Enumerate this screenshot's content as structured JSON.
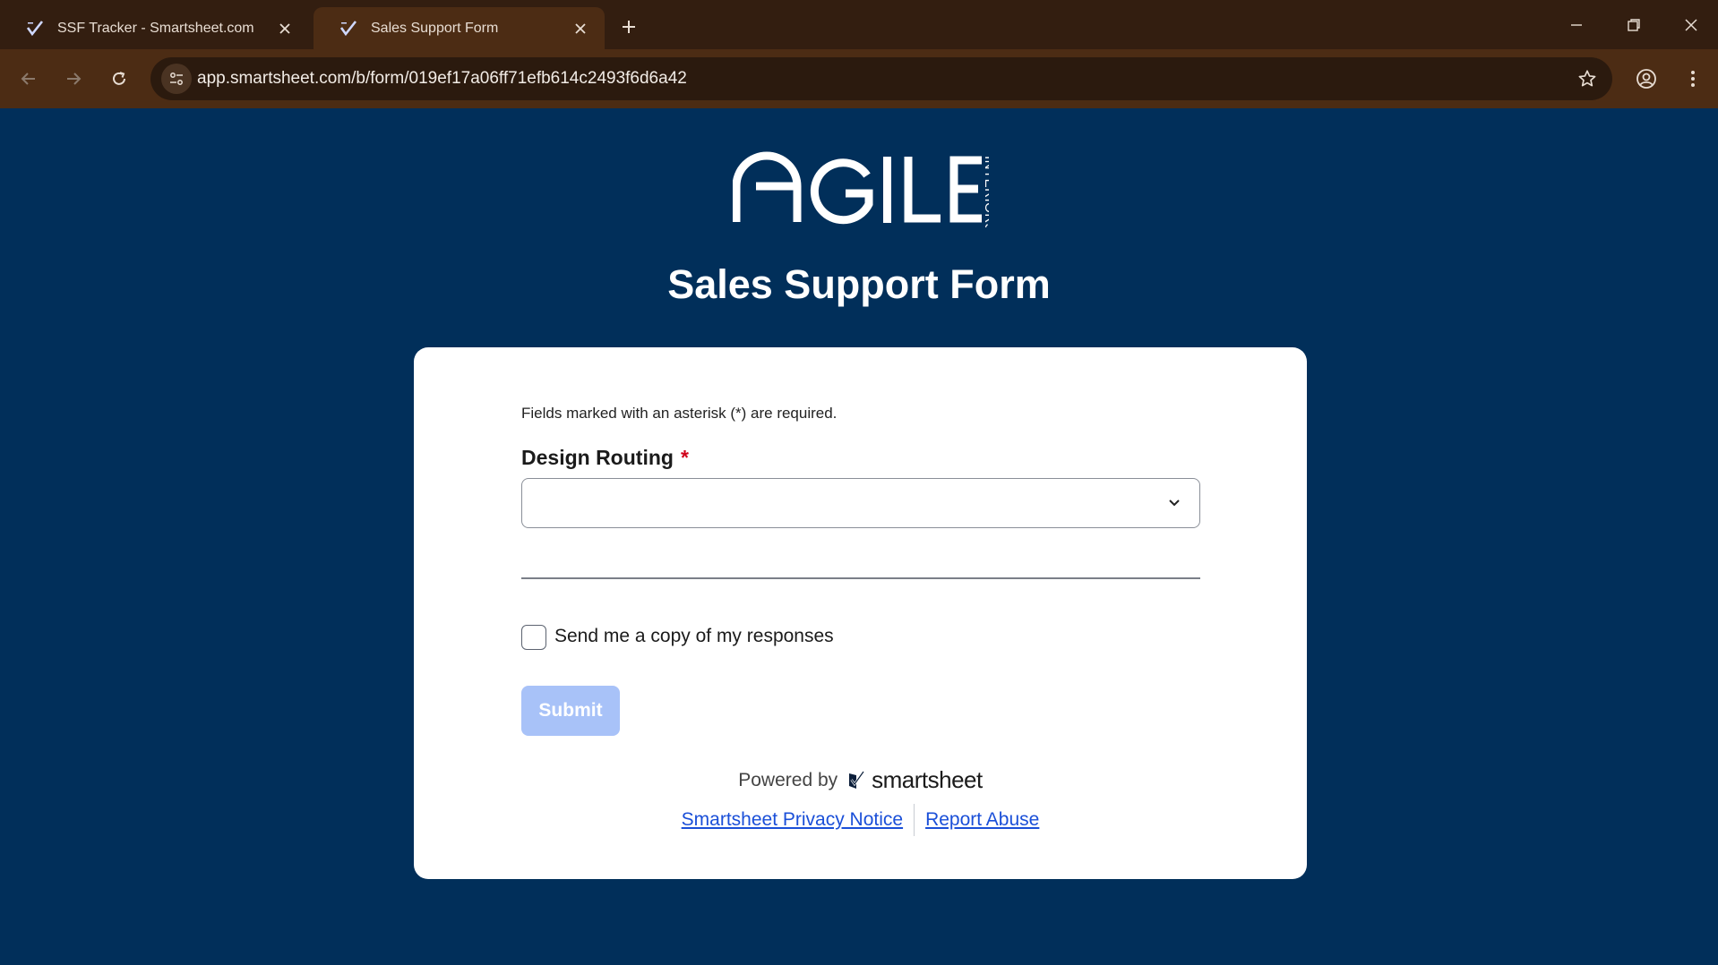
{
  "browser": {
    "tabs": [
      {
        "title": "SSF Tracker - Smartsheet.com",
        "active": false
      },
      {
        "title": "Sales Support Form",
        "active": true
      }
    ],
    "url": "app.smartsheet.com/b/form/019ef17a06ff71efb614c2493f6d6a42"
  },
  "logo": {
    "word": "AGILE",
    "sub": "INTERIORS"
  },
  "form": {
    "title": "Sales Support Form",
    "required_note": "Fields marked with an asterisk (*) are required.",
    "field_label": "Design Routing",
    "required_mark": "*",
    "select_value": "",
    "copy_label": "Send me a copy of my responses",
    "submit_label": "Submit",
    "powered_by": "Powered by",
    "brand": "smartsheet",
    "privacy_link": "Smartsheet Privacy Notice",
    "abuse_link": "Report Abuse"
  },
  "colors": {
    "page_bg": "#012f5a",
    "chrome_bg": "#331e10",
    "toolbar_bg": "#4c2c14",
    "submit_disabled": "#a8c2f8",
    "link": "#1a4fd8",
    "required": "#d0021b"
  }
}
